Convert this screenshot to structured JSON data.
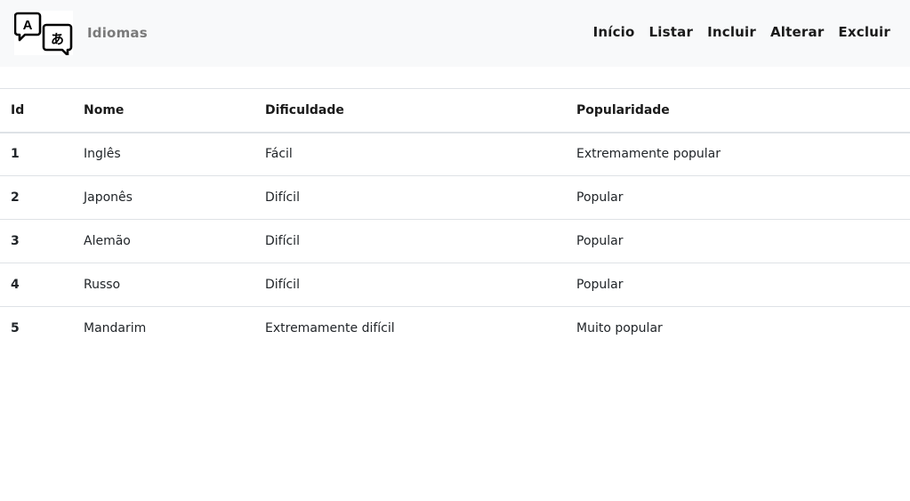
{
  "navbar": {
    "brand_text": "Idiomas",
    "logo_icon": "translate-speech-bubbles-icon",
    "links": [
      "Início",
      "Listar",
      "Incluir",
      "Alterar",
      "Excluir"
    ]
  },
  "table": {
    "headers": [
      "Id",
      "Nome",
      "Dificuldade",
      "Popularidade"
    ],
    "rows": [
      [
        "1",
        "Inglês",
        "Fácil",
        "Extremamente popular"
      ],
      [
        "2",
        "Japonês",
        "Difícil",
        "Popular"
      ],
      [
        "3",
        "Alemão",
        "Difícil",
        "Popular"
      ],
      [
        "4",
        "Russo",
        "Difícil",
        "Popular"
      ],
      [
        "5",
        "Mandarim",
        "Extremamente difícil",
        "Muito popular"
      ]
    ]
  }
}
